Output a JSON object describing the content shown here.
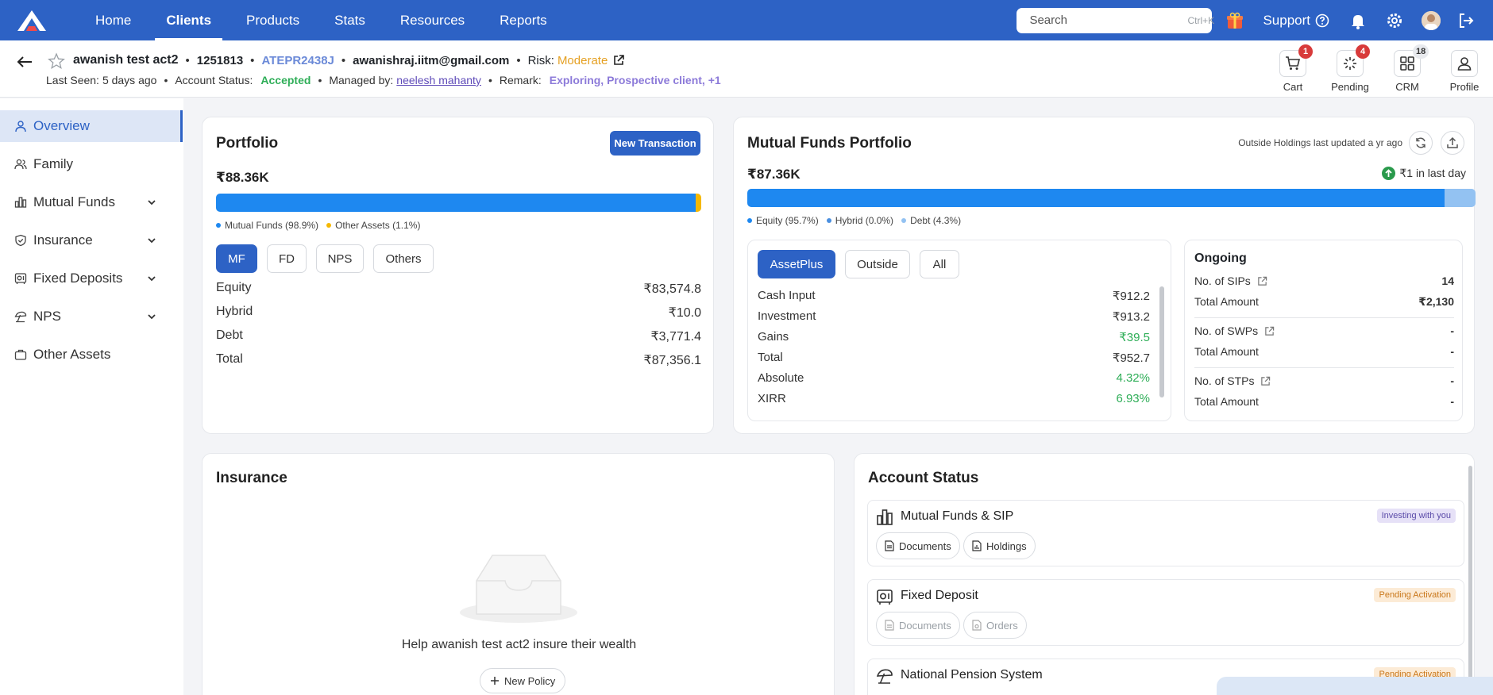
{
  "nav": {
    "links": [
      "Home",
      "Clients",
      "Products",
      "Stats",
      "Resources",
      "Reports"
    ],
    "active": "Clients",
    "search_placeholder": "Search",
    "search_shortcut": "Ctrl+K",
    "support_label": "Support"
  },
  "client": {
    "name": "awanish test act2",
    "id": "1251813",
    "pan": "ATEPR2438J",
    "email": "awanishraj.iitm@gmail.com",
    "risk_label": "Risk:",
    "risk_value": "Moderate",
    "last_seen_label": "Last Seen:",
    "last_seen_value": "5 days ago",
    "account_status_label": "Account Status:",
    "account_status_value": "Accepted",
    "managed_by_label": "Managed by:",
    "managed_by_value": "neelesh mahanty",
    "remark_label": "Remark:",
    "remark_value": "Exploring, Prospective client, +1"
  },
  "header_actions": [
    {
      "label": "Cart",
      "badge": "1",
      "icon": "cart-icon"
    },
    {
      "label": "Pending",
      "badge": "4",
      "icon": "spinner-icon"
    },
    {
      "label": "CRM",
      "badge": "18",
      "icon": "grid-icon"
    },
    {
      "label": "Profile",
      "badge": "",
      "icon": "user-icon"
    }
  ],
  "sidebar": {
    "items": [
      {
        "label": "Overview",
        "icon": "user-icon",
        "expandable": false
      },
      {
        "label": "Family",
        "icon": "users-icon",
        "expandable": false
      },
      {
        "label": "Mutual Funds",
        "icon": "bar-chart-icon",
        "expandable": true
      },
      {
        "label": "Insurance",
        "icon": "shield-icon",
        "expandable": true
      },
      {
        "label": "Fixed Deposits",
        "icon": "vault-icon",
        "expandable": true
      },
      {
        "label": "NPS",
        "icon": "umbrella-icon",
        "expandable": true
      },
      {
        "label": "Other Assets",
        "icon": "briefcase-icon",
        "expandable": false
      }
    ]
  },
  "portfolio": {
    "title": "Portfolio",
    "new_transaction": "New Transaction",
    "total": "₹88.36K",
    "split": [
      {
        "label": "Mutual Funds (98.9%)",
        "pct": 98.9,
        "color": "#1e88f0"
      },
      {
        "label": "Other Assets (1.1%)",
        "pct": 1.1,
        "color": "#f5b800"
      }
    ],
    "tabs": [
      "MF",
      "FD",
      "NPS",
      "Others"
    ],
    "active_tab": "MF",
    "rows": [
      {
        "label": "Equity",
        "value": "₹83,574.8"
      },
      {
        "label": "Hybrid",
        "value": "₹10.0"
      },
      {
        "label": "Debt",
        "value": "₹3,771.4"
      },
      {
        "label": "Total",
        "value": "₹87,356.1"
      }
    ]
  },
  "mf_portfolio": {
    "title": "Mutual Funds Portfolio",
    "updated_text": "Outside Holdings last updated a yr ago",
    "total": "₹87.36K",
    "day_change": "₹1 in last day",
    "split": [
      {
        "label": "Equity (95.7%)",
        "pct": 95.7,
        "color": "#1e88f0"
      },
      {
        "label": "Hybrid (0.0%)",
        "pct": 0.0,
        "color": "#4a8fe0"
      },
      {
        "label": "Debt (4.3%)",
        "pct": 4.3,
        "color": "#93c2f2"
      }
    ],
    "tabs": [
      "AssetPlus",
      "Outside",
      "All"
    ],
    "active_tab": "AssetPlus",
    "rows": [
      {
        "label": "Cash Input",
        "value": "₹912.2",
        "green": false
      },
      {
        "label": "Investment",
        "value": "₹913.2",
        "green": false
      },
      {
        "label": "Gains",
        "value": "₹39.5",
        "green": true
      },
      {
        "label": "Total",
        "value": "₹952.7",
        "green": false
      },
      {
        "label": "Absolute",
        "value": "4.32%",
        "green": true
      },
      {
        "label": "XIRR",
        "value": "6.93%",
        "green": true
      }
    ],
    "ongoing": {
      "title": "Ongoing",
      "groups": [
        {
          "label": "No. of SIPs",
          "count": "14",
          "amount_label": "Total Amount",
          "amount": "₹2,130"
        },
        {
          "label": "No. of SWPs",
          "count": "-",
          "amount_label": "Total Amount",
          "amount": "-"
        },
        {
          "label": "No. of STPs",
          "count": "-",
          "amount_label": "Total Amount",
          "amount": "-"
        }
      ]
    }
  },
  "insurance": {
    "title": "Insurance",
    "empty_text": "Help awanish test act2 insure their wealth",
    "new_policy": "New Policy"
  },
  "account_status": {
    "title": "Account Status",
    "items": [
      {
        "title": "Mutual Funds & SIP",
        "tag": "Investing with you",
        "tag_style": "purple",
        "pills": [
          "Documents",
          "Holdings"
        ],
        "dim": false
      },
      {
        "title": "Fixed Deposit",
        "tag": "Pending Activation",
        "tag_style": "orange",
        "pills": [
          "Documents",
          "Orders"
        ],
        "dim": true
      },
      {
        "title": "National Pension System",
        "tag": "Pending Activation",
        "tag_style": "orange",
        "pills": [],
        "dim": true
      }
    ]
  }
}
